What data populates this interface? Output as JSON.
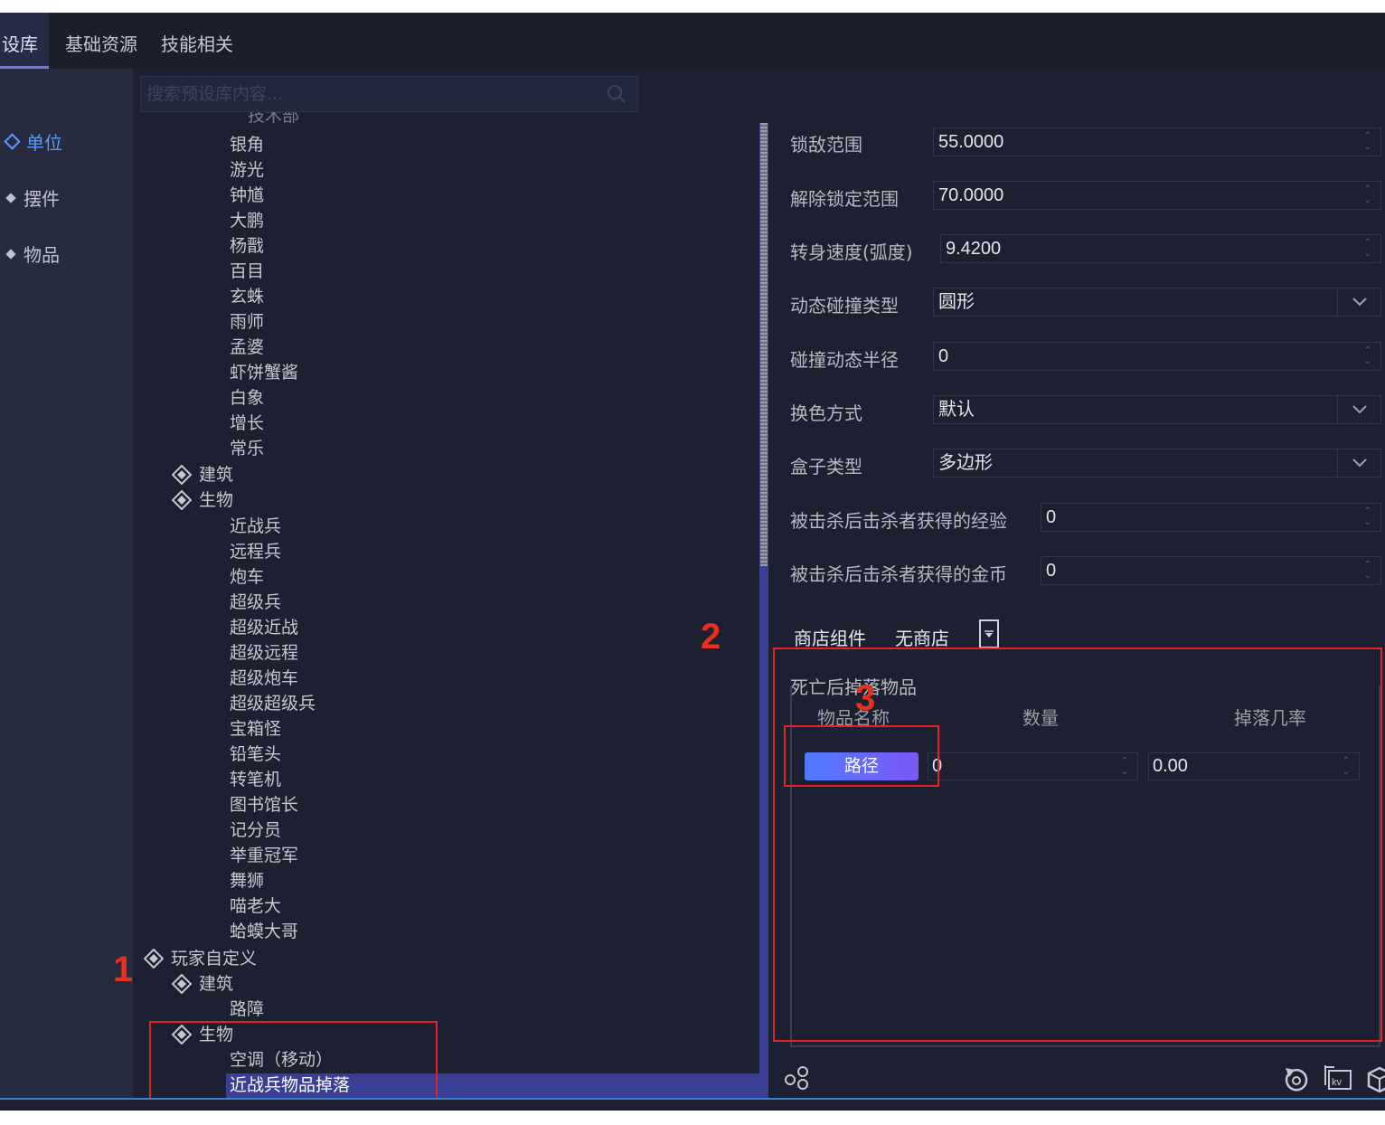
{
  "top_tabs": [
    "设库",
    "基础资源",
    "技能相关"
  ],
  "categories": [
    "单位",
    "摆件",
    "物品"
  ],
  "search": {
    "placeholder": "搜索预设库内容..."
  },
  "tree": {
    "partial_top": "技术部",
    "heroes": [
      "银角",
      "游光",
      "钟馗",
      "大鹏",
      "杨戬",
      "百目",
      "玄蛛",
      "雨师",
      "孟婆",
      "虾饼蟹酱",
      "白象",
      "增长",
      "常乐"
    ],
    "group_building": "建筑",
    "group_creature": "生物",
    "creatures": [
      "近战兵",
      "远程兵",
      "炮车",
      "超级兵",
      "超级近战",
      "超级远程",
      "超级炮车",
      "超级超级兵",
      "宝箱怪",
      "铅笔头",
      "转笔机",
      "图书馆长",
      "记分员",
      "举重冠军",
      "舞狮",
      "喵老大",
      "蛤蟆大哥"
    ],
    "custom_group": "玩家自定义",
    "custom_building": "建筑",
    "custom_building_items": [
      "路障"
    ],
    "custom_creature": "生物",
    "custom_creature_items": [
      "空调（移动）",
      "近战兵物品掉落"
    ]
  },
  "props": {
    "lock_range": {
      "label": "锁敌范围",
      "value": "55.0000"
    },
    "unlock_range": {
      "label": "解除锁定范围",
      "value": "70.0000"
    },
    "turn_speed": {
      "label": "转身速度(弧度)",
      "value": "9.4200"
    },
    "collision_type": {
      "label": "动态碰撞类型",
      "value": "圆形"
    },
    "collision_radius": {
      "label": "碰撞动态半径",
      "value": "0"
    },
    "recolor": {
      "label": "换色方式",
      "value": "默认"
    },
    "box_type": {
      "label": "盒子类型",
      "value": "多边形"
    },
    "kill_exp": {
      "label": "被击杀后击杀者获得的经验",
      "value": "0"
    },
    "kill_gold": {
      "label": "被击杀后击杀者获得的金币",
      "value": "0"
    }
  },
  "shop": {
    "label": "商店组件",
    "value": "无商店"
  },
  "drops": {
    "title": "死亡后掉落物品",
    "columns": [
      "物品名称",
      "数量",
      "掉落几率"
    ],
    "row": {
      "button": "路径",
      "quantity": "0",
      "chance": "0.00"
    }
  },
  "annotations": [
    "1",
    "2",
    "3"
  ],
  "colors": {
    "accent": "#3a3f96",
    "annotation": "#e02424",
    "button_gradient_start": "#4f7bff",
    "button_gradient_end": "#7a58f4"
  }
}
